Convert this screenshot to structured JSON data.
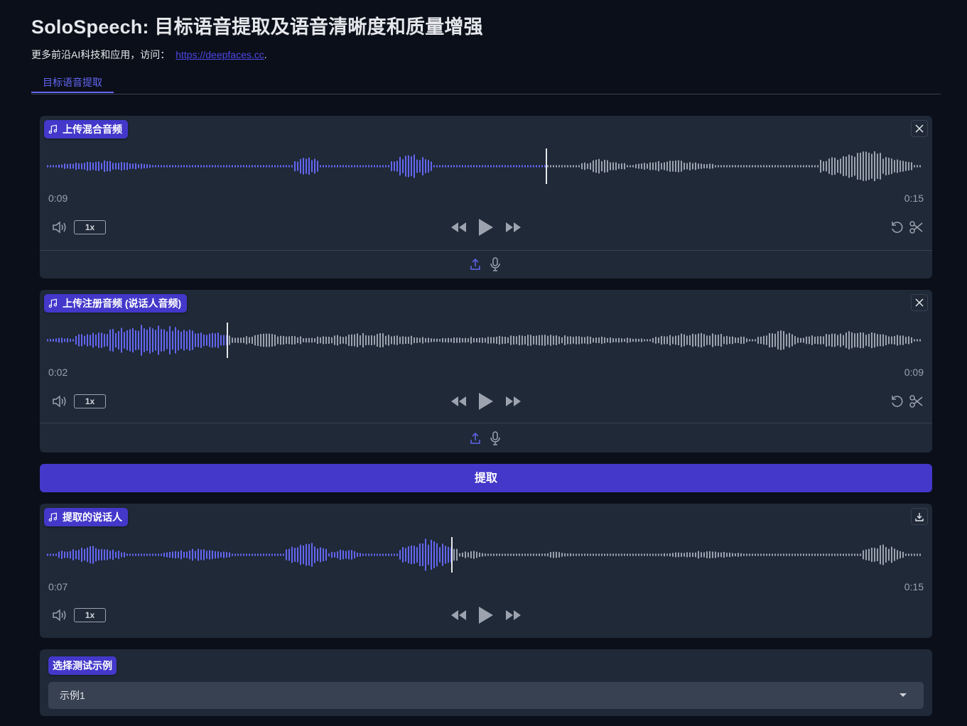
{
  "header": {
    "title": "SoloSpeech: 目标语音提取及语音清晰度和质量增强",
    "subtitle_prefix": "更多前沿AI科技和应用，访问：",
    "link_text": "https://deepfaces.cc",
    "subtitle_suffix": "."
  },
  "tabs": [
    {
      "label": "目标语音提取",
      "active": true
    }
  ],
  "mix_audio": {
    "label": "上传混合音频",
    "current_time": "0:09",
    "duration": "0:15",
    "progress": 0.57,
    "rate": "1x"
  },
  "enroll_audio": {
    "label": "上传注册音频 (说话人音频)",
    "current_time": "0:02",
    "duration": "0:09",
    "progress": 0.205,
    "rate": "1x"
  },
  "extract_button": {
    "label": "提取"
  },
  "output_audio": {
    "label": "提取的说话人",
    "current_time": "0:07",
    "duration": "0:15",
    "progress": 0.462,
    "rate": "1x"
  },
  "examples": {
    "label": "选择测试示例",
    "selected": "示例1"
  },
  "colors": {
    "background": "#0b0f19",
    "panel": "#1f2937",
    "accent": "#4338ca",
    "wave_played": "#6366f1",
    "wave_unplayed": "#9ca3af"
  },
  "icons": [
    "music-note-icon",
    "close-icon",
    "download-icon",
    "volume-icon",
    "rewind-icon",
    "play-icon",
    "fast-forward-icon",
    "undo-icon",
    "scissors-icon",
    "upload-icon",
    "microphone-icon",
    "chevron-down-icon"
  ]
}
